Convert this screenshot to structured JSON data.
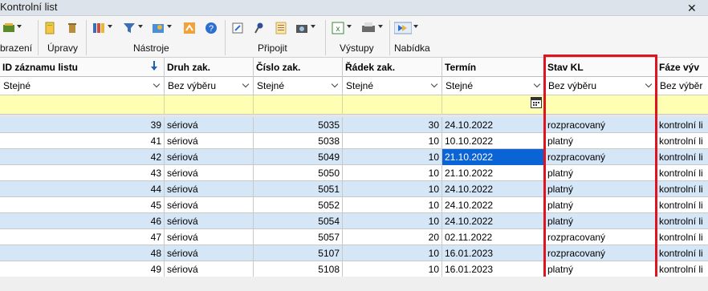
{
  "window": {
    "title": "Kontrolní list"
  },
  "ribbon": {
    "groups": [
      {
        "label": "brazení"
      },
      {
        "label": "Úpravy"
      },
      {
        "label": "Nástroje"
      },
      {
        "label": "Připojit"
      },
      {
        "label": "Výstupy"
      },
      {
        "label": "Nabídka"
      }
    ]
  },
  "grid": {
    "columns": [
      {
        "label": "ID záznamu listu"
      },
      {
        "label": "Druh zak."
      },
      {
        "label": "Číslo zak."
      },
      {
        "label": "Řádek zak."
      },
      {
        "label": "Termín"
      },
      {
        "label": "Stav KL"
      },
      {
        "label": "Fáze výv"
      }
    ],
    "filters": [
      "Stejné",
      "Bez výběru",
      "Stejné",
      "Stejné",
      "Stejné",
      "Bez výběru",
      "Bez výběr"
    ],
    "rows": [
      {
        "id": "39",
        "druh": "sériová",
        "cislo": "5035",
        "radek": "30",
        "termin": "24.10.2022",
        "stav": "rozpracovaný",
        "faze": "kontrolní li"
      },
      {
        "id": "41",
        "druh": "sériová",
        "cislo": "5038",
        "radek": "10",
        "termin": "10.10.2022",
        "stav": "platný",
        "faze": "kontrolní li"
      },
      {
        "id": "42",
        "druh": "sériová",
        "cislo": "5049",
        "radek": "10",
        "termin": "21.10.2022",
        "stav": "rozpracovaný",
        "faze": "kontrolní li"
      },
      {
        "id": "43",
        "druh": "sériová",
        "cislo": "5050",
        "radek": "10",
        "termin": "21.10.2022",
        "stav": "platný",
        "faze": "kontrolní li"
      },
      {
        "id": "44",
        "druh": "sériová",
        "cislo": "5051",
        "radek": "10",
        "termin": "24.10.2022",
        "stav": "platný",
        "faze": "kontrolní li"
      },
      {
        "id": "45",
        "druh": "sériová",
        "cislo": "5052",
        "radek": "10",
        "termin": "24.10.2022",
        "stav": "platný",
        "faze": "kontrolní li"
      },
      {
        "id": "46",
        "druh": "sériová",
        "cislo": "5054",
        "radek": "10",
        "termin": "24.10.2022",
        "stav": "platný",
        "faze": "kontrolní li"
      },
      {
        "id": "47",
        "druh": "sériová",
        "cislo": "5057",
        "radek": "20",
        "termin": "02.11.2022",
        "stav": "rozpracovaný",
        "faze": "kontrolní li"
      },
      {
        "id": "48",
        "druh": "sériová",
        "cislo": "5107",
        "radek": "10",
        "termin": "16.01.2023",
        "stav": "rozpracovaný",
        "faze": "kontrolní li"
      },
      {
        "id": "49",
        "druh": "sériová",
        "cislo": "5108",
        "radek": "10",
        "termin": "16.01.2023",
        "stav": "platný",
        "faze": "kontrolní li"
      }
    ],
    "selected_row_index": 2,
    "selected_column": "termin",
    "highlight_color": "#e0141e",
    "selection_color": "#0a64d6",
    "row_alt_color": "#d5e6f7",
    "filter_row_color": "#ffffb3"
  }
}
